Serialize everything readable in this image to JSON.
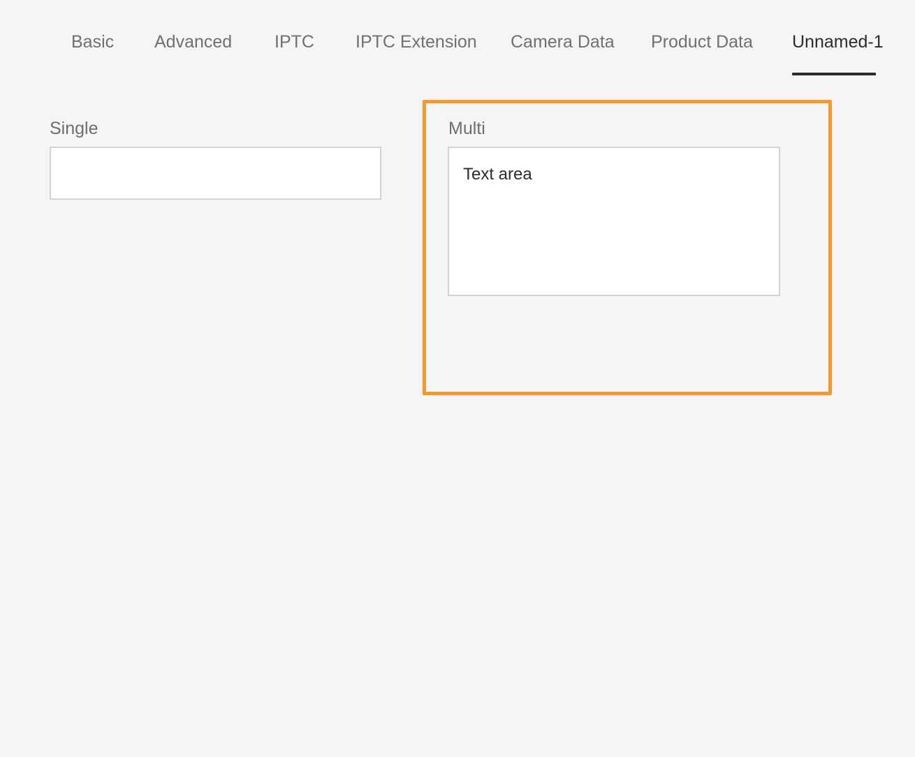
{
  "tabs": [
    {
      "label": "Basic",
      "active": false
    },
    {
      "label": "Advanced",
      "active": false
    },
    {
      "label": "IPTC",
      "active": false
    },
    {
      "label": "IPTC Extension",
      "active": false
    },
    {
      "label": "Camera Data",
      "active": false
    },
    {
      "label": "Product Data",
      "active": false
    },
    {
      "label": "Unnamed-1",
      "active": true
    }
  ],
  "fields": {
    "single": {
      "label": "Single",
      "value": ""
    },
    "multi": {
      "label": "Multi",
      "value": "Text area"
    }
  },
  "colors": {
    "background": "#f5f5f5",
    "highlight": "#f59a2a",
    "active_tab": "#2c2c2c",
    "inactive_tab": "#707070"
  }
}
